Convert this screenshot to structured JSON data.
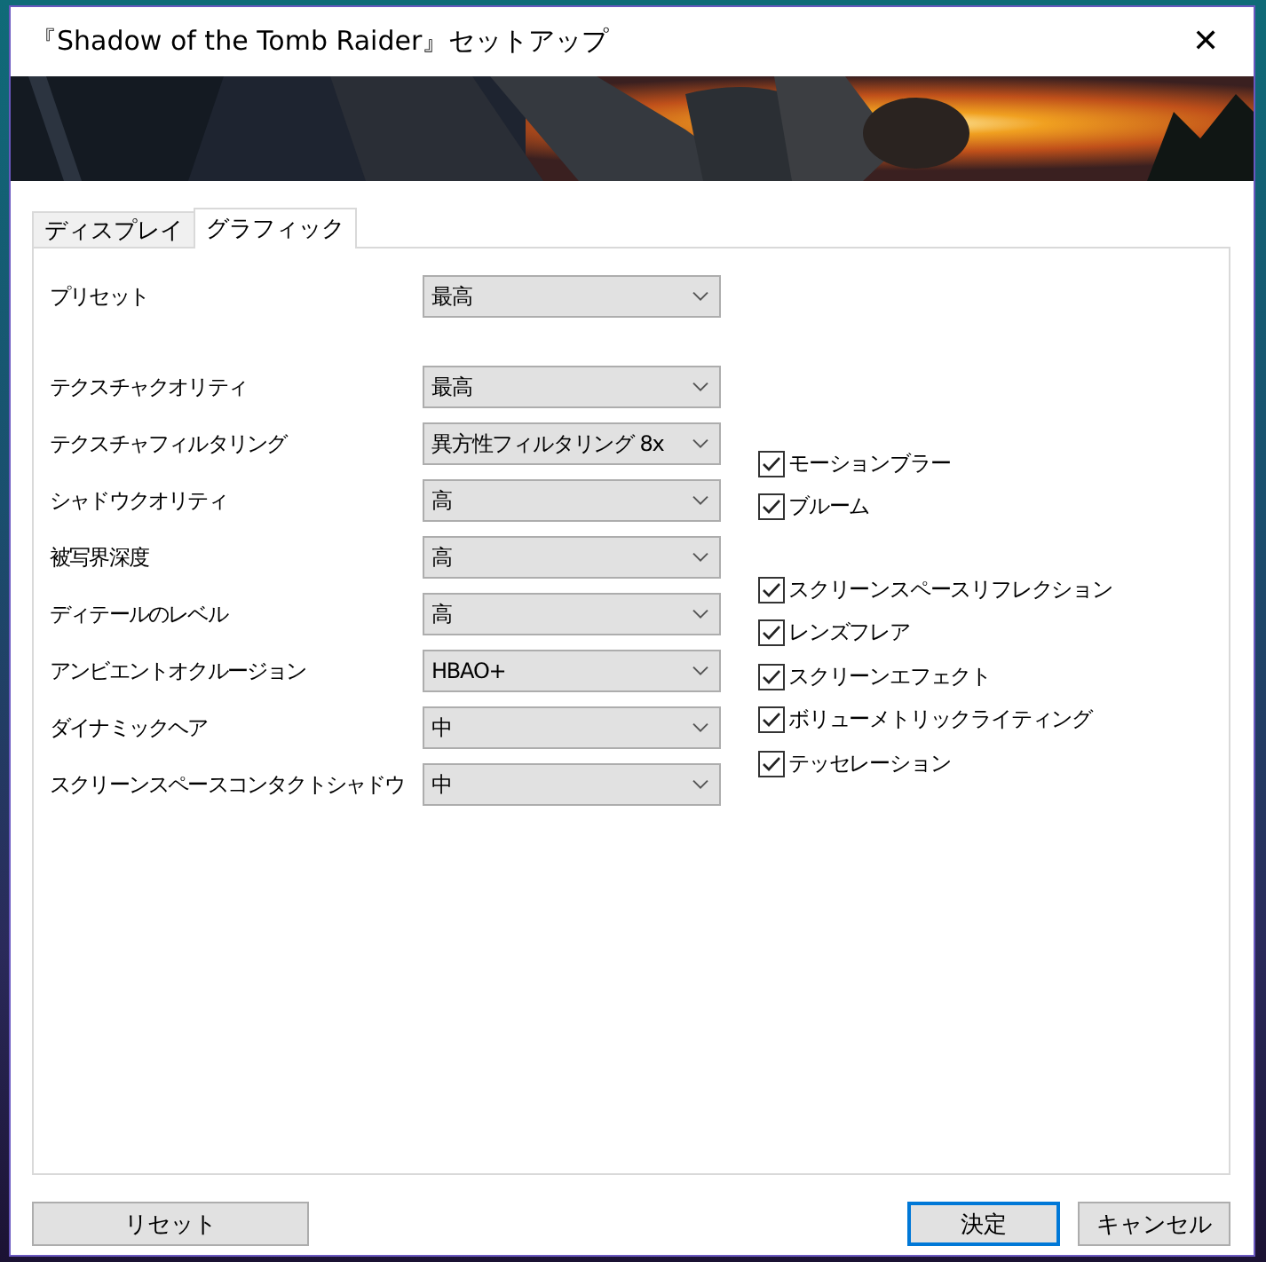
{
  "window": {
    "title": "『Shadow of the Tomb Raider』セットアップ",
    "close": "✕"
  },
  "banner": {
    "kind": "picture"
  },
  "tabs": [
    {
      "label": "ディスプレイ",
      "selected": false
    },
    {
      "label": "グラフィック",
      "selected": true
    }
  ],
  "preset": {
    "label": "プリセット",
    "value": "最高"
  },
  "settings": [
    {
      "label": "テクスチャクオリティ",
      "value": "最高"
    },
    {
      "label": "テクスチャフィルタリング",
      "value": "異方性フィルタリング 8x"
    },
    {
      "label": "シャドウクオリティ",
      "value": "高"
    },
    {
      "label": "被写界深度",
      "value": "高"
    },
    {
      "label": "ディテールのレベル",
      "value": "高"
    },
    {
      "label": "アンビエントオクルージョン",
      "value": "HBAO+"
    },
    {
      "label": "ダイナミックヘア",
      "value": "中"
    },
    {
      "label": "スクリーンスペースコンタクトシャドウ",
      "value": "中"
    }
  ],
  "checkbox_groups": [
    [
      {
        "label": "モーションブラー",
        "checked": true
      },
      {
        "label": "ブルーム",
        "checked": true
      }
    ],
    [
      {
        "label": "スクリーンスペースリフレクション",
        "checked": true
      },
      {
        "label": "レンズフレア",
        "checked": true
      },
      {
        "label": "スクリーンエフェクト",
        "checked": true
      },
      {
        "label": "ボリューメトリックライティング",
        "checked": true
      },
      {
        "label": "テッセレーション",
        "checked": true
      }
    ]
  ],
  "buttons": [
    {
      "label": "リセット",
      "default": false
    },
    {
      "label": "決定",
      "default": true
    },
    {
      "label": "キャンセル",
      "default": false
    }
  ]
}
